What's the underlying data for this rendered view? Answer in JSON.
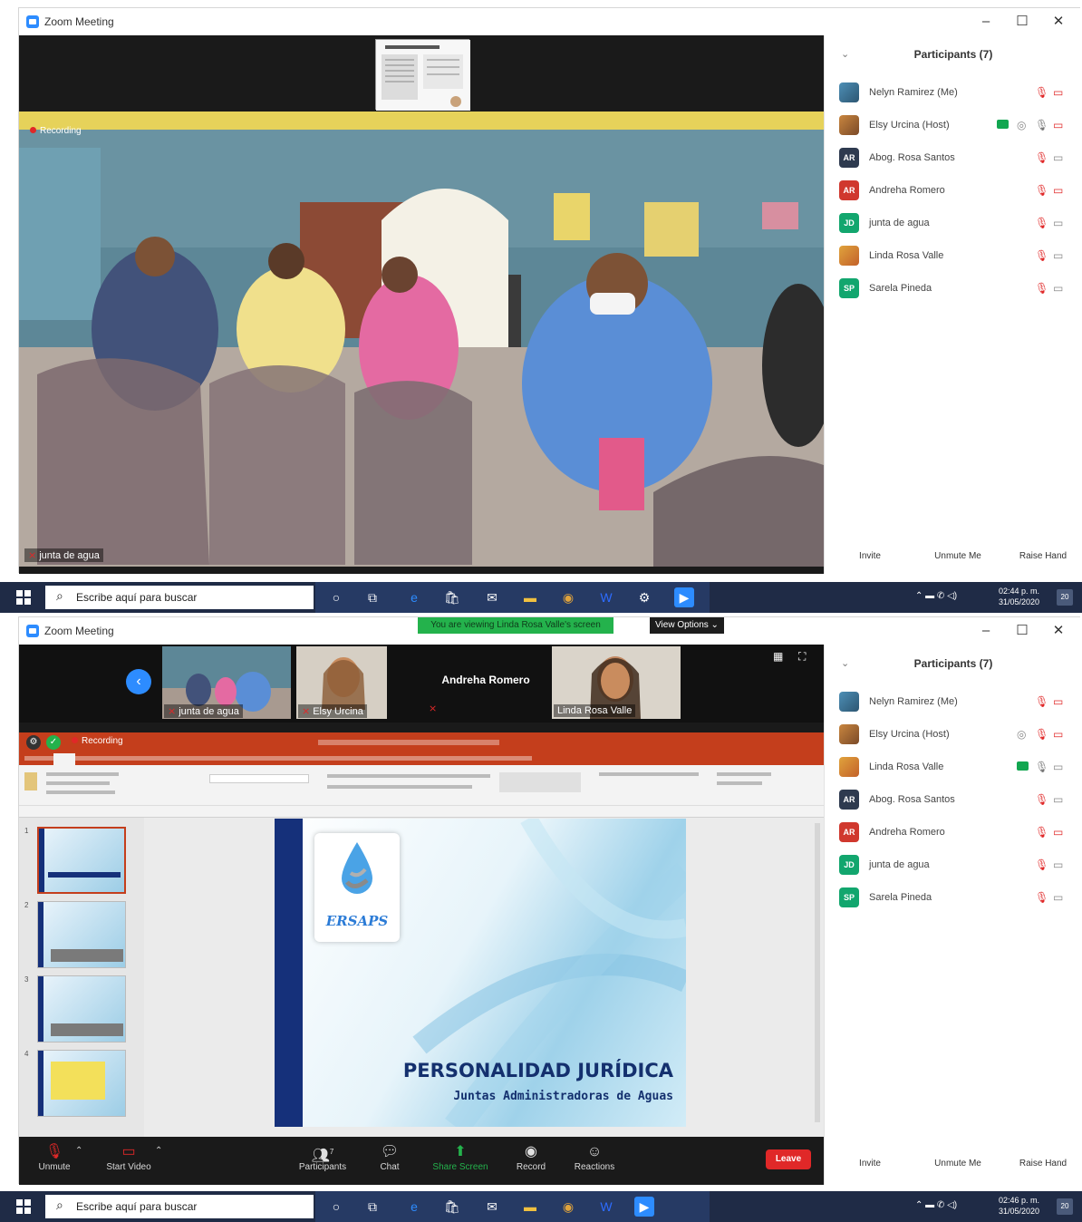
{
  "window_title": "Zoom Meeting",
  "window_controls": {
    "minimize": "–",
    "maximize": "☐",
    "close": "✕"
  },
  "shot1": {
    "recording_label": "Recording",
    "speaker_name": "junta de agua",
    "participants_header": "Participants (7)",
    "participants": [
      {
        "name": "Nelyn Ramirez (Me)",
        "initials": "",
        "avatar_color": "#3f7fb0"
      },
      {
        "name": "Elsy Urcina (Host)",
        "initials": "",
        "avatar_color": "#c9863f"
      },
      {
        "name": "Abog. Rosa Santos",
        "initials": "AR",
        "avatar_color": "#2e3a4f"
      },
      {
        "name": "Andreha Romero",
        "initials": "AR",
        "avatar_color": "#d0382e"
      },
      {
        "name": "junta de agua",
        "initials": "JD",
        "avatar_color": "#12a66e"
      },
      {
        "name": "Linda Rosa Valle",
        "initials": "",
        "avatar_color": "#e0a33c"
      },
      {
        "name": "Sarela Pineda",
        "initials": "SP",
        "avatar_color": "#12a66e"
      }
    ],
    "footer": {
      "invite": "Invite",
      "unmute": "Unmute Me",
      "raise_hand": "Raise Hand"
    }
  },
  "shot2": {
    "banner": "You are viewing Linda Rosa Valle's screen",
    "view_options": "View Options ⌄",
    "thumbnails": [
      {
        "name": "junta de agua"
      },
      {
        "name": "Elsy Urcina"
      },
      {
        "name": "Andreha Romero"
      },
      {
        "name": "Linda Rosa Valle"
      }
    ],
    "recording_label": "Recording",
    "slide": {
      "logo": "ERSAPS",
      "title": "PERSONALIDAD JURÍDICA",
      "subtitle": "Juntas Administradoras de Aguas"
    },
    "slide_numbers": [
      "1",
      "2",
      "3",
      "4"
    ],
    "participants_header": "Participants (7)",
    "participants": [
      {
        "name": "Nelyn Ramirez (Me)",
        "initials": "",
        "avatar_color": "#3f7fb0"
      },
      {
        "name": "Elsy Urcina (Host)",
        "initials": "",
        "avatar_color": "#c9863f"
      },
      {
        "name": "Linda Rosa Valle",
        "initials": "",
        "avatar_color": "#e0a33c"
      },
      {
        "name": "Abog. Rosa Santos",
        "initials": "AR",
        "avatar_color": "#2e3a4f"
      },
      {
        "name": "Andreha Romero",
        "initials": "AR",
        "avatar_color": "#d0382e"
      },
      {
        "name": "junta de agua",
        "initials": "JD",
        "avatar_color": "#12a66e"
      },
      {
        "name": "Sarela Pineda",
        "initials": "SP",
        "avatar_color": "#12a66e"
      }
    ],
    "toolbar": {
      "unmute": "Unmute",
      "start_video": "Start Video",
      "participants": "Participants",
      "participants_count": "7",
      "chat": "Chat",
      "share_screen": "Share Screen",
      "record": "Record",
      "reactions": "Reactions",
      "leave": "Leave"
    },
    "footer": {
      "invite": "Invite",
      "unmute": "Unmute Me",
      "raise_hand": "Raise Hand"
    }
  },
  "taskbar1": {
    "search_placeholder": "Escribe aquí para buscar",
    "time": "02:44 p. m.",
    "date": "31/05/2020",
    "notifications": "20"
  },
  "taskbar2": {
    "search_placeholder": "Escribe aquí para buscar",
    "time": "02:46 p. m.",
    "date": "31/05/2020",
    "notifications": "20"
  },
  "colors": {
    "zoom_blue": "#2d8cff",
    "mute_red": "#e02828",
    "share_green": "#24b24c",
    "ppt_orange": "#c43e1c",
    "taskbar": "#1f2b46"
  }
}
